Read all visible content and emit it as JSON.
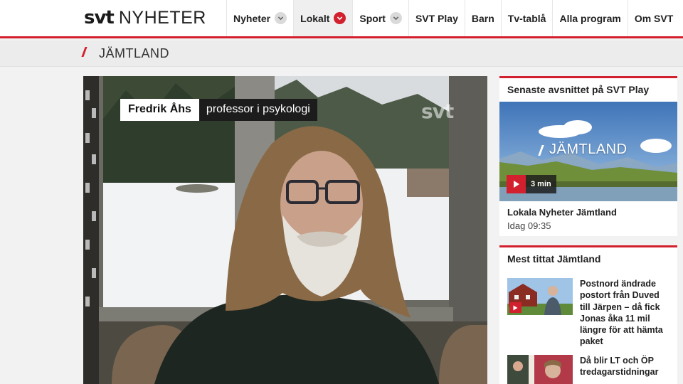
{
  "header": {
    "logo_svt": "svt",
    "logo_nyheter": "NYHETER",
    "nav": [
      {
        "label": "Nyheter",
        "dropdown": true,
        "active": false
      },
      {
        "label": "Lokalt",
        "dropdown": true,
        "active": true
      },
      {
        "label": "Sport",
        "dropdown": true,
        "active": false
      },
      {
        "label": "SVT Play",
        "dropdown": false,
        "active": false
      },
      {
        "label": "Barn",
        "dropdown": false,
        "active": false
      },
      {
        "label": "Tv-tablå",
        "dropdown": false,
        "active": false
      },
      {
        "label": "Alla program",
        "dropdown": false,
        "active": false
      },
      {
        "label": "Om SVT",
        "dropdown": false,
        "active": false
      }
    ],
    "accent_color": "#d3202e"
  },
  "section": {
    "title": "JÄMTLAND"
  },
  "video": {
    "name": "Fredrik Åhs",
    "role": "professor i psykologi",
    "watermark": "svt"
  },
  "sidebar": {
    "latest": {
      "heading": "Senaste avsnittet på SVT Play",
      "thumb_label": "JÄMTLAND",
      "duration": "3 min",
      "episode_title": "Lokala Nyheter Jämtland",
      "episode_time": "Idag 09:35"
    },
    "most_viewed": {
      "heading": "Mest tittat Jämtland",
      "items": [
        {
          "title": "Postnord ändrade postort från Duved till Järpen – då fick Jonas åka 11 mil längre för att hämta paket"
        },
        {
          "title": "Då blir LT och ÖP tredagarstidningar"
        }
      ]
    }
  }
}
